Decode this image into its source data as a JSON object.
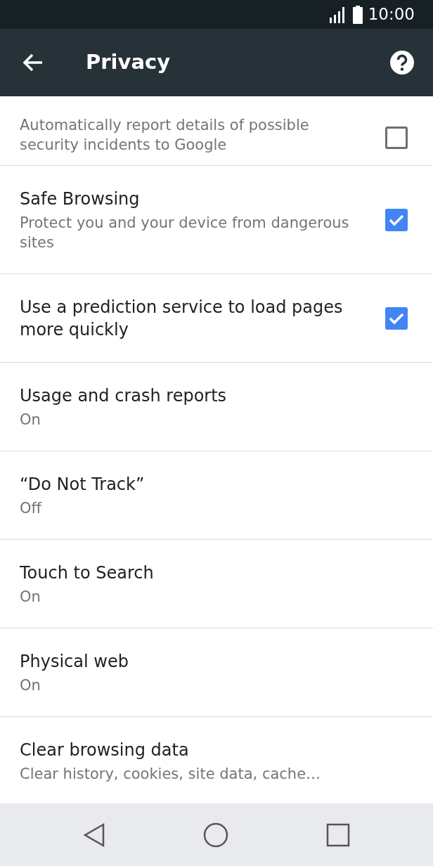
{
  "status_bar": {
    "time": "10:00"
  },
  "app_bar": {
    "title": "Privacy"
  },
  "settings": [
    {
      "kind": "checkbox",
      "subtitle": "Automatically report details of possible security incidents to Google",
      "checked": false
    },
    {
      "kind": "checkbox",
      "title": "Safe Browsing",
      "subtitle": "Protect you and your device from dangerous sites",
      "checked": true
    },
    {
      "kind": "checkbox",
      "title": "Use a prediction service to load pages more quickly",
      "checked": true
    },
    {
      "kind": "link",
      "title": "Usage and crash reports",
      "subtitle": "On"
    },
    {
      "kind": "link",
      "title": "“Do Not Track”",
      "subtitle": "Off"
    },
    {
      "kind": "link",
      "title": "Touch to Search",
      "subtitle": "On"
    },
    {
      "kind": "link",
      "title": "Physical web",
      "subtitle": "On"
    },
    {
      "kind": "link",
      "title": "Clear browsing data",
      "subtitle": "Clear history, cookies, site data, cache…"
    }
  ]
}
